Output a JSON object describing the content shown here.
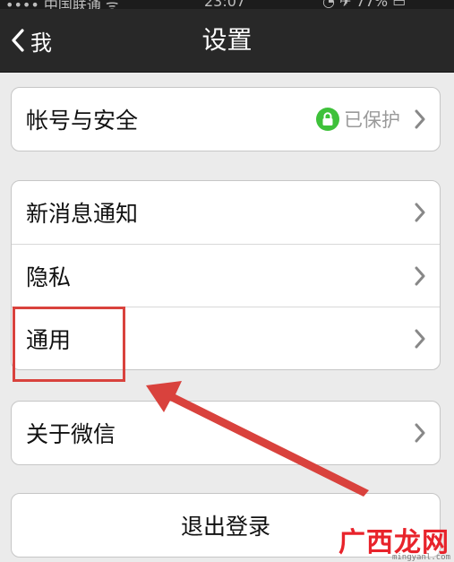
{
  "nav": {
    "back_label": "我",
    "title": "设置"
  },
  "groups": [
    [
      {
        "label": "帐号与安全",
        "status": "已保护",
        "status_icon": "lock-icon",
        "status_icon_color": "#3ec13a"
      }
    ],
    [
      {
        "label": "新消息通知"
      },
      {
        "label": "隐私"
      },
      {
        "label": "通用"
      }
    ],
    [
      {
        "label": "关于微信"
      }
    ]
  ],
  "logout_label": "退出登录",
  "annotation": {
    "highlight_color": "#d9423d"
  },
  "watermark": {
    "text": "广西龙网",
    "url": "mingyanl.com",
    "color": "#e8232b"
  }
}
